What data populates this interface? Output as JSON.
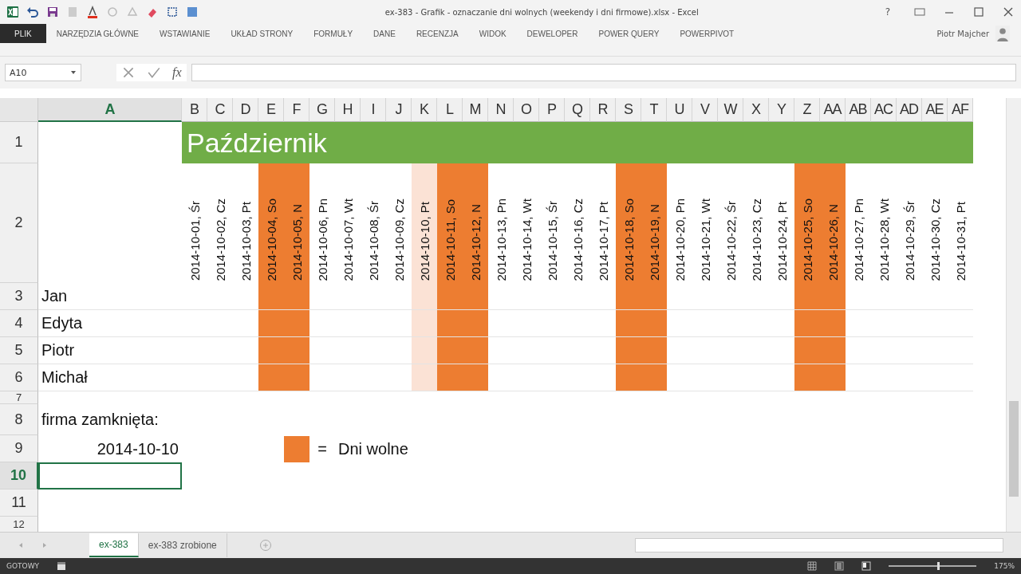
{
  "title_bar": {
    "title": "ex-383 - Grafik - oznaczanie dni wolnych (weekendy i dni firmowe).xlsx - Excel",
    "help": "?"
  },
  "ribbon_tabs": [
    {
      "label": "PLIK",
      "kind": "file",
      "selected": false
    },
    {
      "label": "NARZĘDZIA GŁÓWNE",
      "kind": "tab",
      "selected": false
    },
    {
      "label": "WSTAWIANIE",
      "kind": "tab",
      "selected": false
    },
    {
      "label": "UKŁAD STRONY",
      "kind": "tab",
      "selected": false
    },
    {
      "label": "FORMUŁY",
      "kind": "tab",
      "selected": false
    },
    {
      "label": "DANE",
      "kind": "tab",
      "selected": false
    },
    {
      "label": "RECENZJA",
      "kind": "tab",
      "selected": false
    },
    {
      "label": "WIDOK",
      "kind": "tab",
      "selected": false
    },
    {
      "label": "DEWELOPER",
      "kind": "tab",
      "selected": false
    },
    {
      "label": "POWER QUERY",
      "kind": "tab",
      "selected": false
    },
    {
      "label": "POWERPIVOT",
      "kind": "tab",
      "selected": false
    }
  ],
  "user": "Piotr Majcher",
  "formula_bar": {
    "name_box": "A10",
    "fx": "fx"
  },
  "sheet": {
    "first_column": {
      "letter": "A",
      "selected": true
    },
    "month_title": "Październik",
    "days": [
      {
        "letter": "B",
        "label": "2014-10-01, Śr",
        "kind": "workday"
      },
      {
        "letter": "C",
        "label": "2014-10-02, Cz",
        "kind": "workday"
      },
      {
        "letter": "D",
        "label": "2014-10-03, Pt",
        "kind": "workday"
      },
      {
        "letter": "E",
        "label": "2014-10-04, So",
        "kind": "weekend"
      },
      {
        "letter": "F",
        "label": "2014-10-05, N",
        "kind": "weekend"
      },
      {
        "letter": "G",
        "label": "2014-10-06, Pn",
        "kind": "workday"
      },
      {
        "letter": "H",
        "label": "2014-10-07, Wt",
        "kind": "workday"
      },
      {
        "letter": "I",
        "label": "2014-10-08, Śr",
        "kind": "workday"
      },
      {
        "letter": "J",
        "label": "2014-10-09, Cz",
        "kind": "workday"
      },
      {
        "letter": "K",
        "label": "2014-10-10, Pt",
        "kind": "closed"
      },
      {
        "letter": "L",
        "label": "2014-10-11, So",
        "kind": "weekend"
      },
      {
        "letter": "M",
        "label": "2014-10-12, N",
        "kind": "weekend"
      },
      {
        "letter": "N",
        "label": "2014-10-13, Pn",
        "kind": "workday"
      },
      {
        "letter": "O",
        "label": "2014-10-14, Wt",
        "kind": "workday"
      },
      {
        "letter": "P",
        "label": "2014-10-15, Śr",
        "kind": "workday"
      },
      {
        "letter": "Q",
        "label": "2014-10-16, Cz",
        "kind": "workday"
      },
      {
        "letter": "R",
        "label": "2014-10-17, Pt",
        "kind": "workday"
      },
      {
        "letter": "S",
        "label": "2014-10-18, So",
        "kind": "weekend"
      },
      {
        "letter": "T",
        "label": "2014-10-19, N",
        "kind": "weekend"
      },
      {
        "letter": "U",
        "label": "2014-10-20, Pn",
        "kind": "workday"
      },
      {
        "letter": "V",
        "label": "2014-10-21, Wt",
        "kind": "workday"
      },
      {
        "letter": "W",
        "label": "2014-10-22, Śr",
        "kind": "workday"
      },
      {
        "letter": "X",
        "label": "2014-10-23, Cz",
        "kind": "workday"
      },
      {
        "letter": "Y",
        "label": "2014-10-24, Pt",
        "kind": "workday"
      },
      {
        "letter": "Z",
        "label": "2014-10-25, So",
        "kind": "weekend"
      },
      {
        "letter": "AA",
        "label": "2014-10-26, N",
        "kind": "weekend"
      },
      {
        "letter": "AB",
        "label": "2014-10-27, Pn",
        "kind": "workday"
      },
      {
        "letter": "AC",
        "label": "2014-10-28, Wt",
        "kind": "workday"
      },
      {
        "letter": "AD",
        "label": "2014-10-29, Śr",
        "kind": "workday"
      },
      {
        "letter": "AE",
        "label": "2014-10-30, Cz",
        "kind": "workday"
      },
      {
        "letter": "AF",
        "label": "2014-10-31, Pt",
        "kind": "workday"
      }
    ],
    "people": [
      "Jan",
      "Edyta",
      "Piotr",
      "Michał"
    ],
    "closed_label": "firma zamknięta:",
    "closed_date": "2014-10-10",
    "legend": {
      "color": "#ed7d31",
      "symbol": "=",
      "label": "Dni wolne"
    },
    "row_headers": [
      {
        "label": "1",
        "selected": false
      },
      {
        "label": "2",
        "selected": false
      },
      {
        "label": "3",
        "selected": false
      },
      {
        "label": "4",
        "selected": false
      },
      {
        "label": "5",
        "selected": false
      },
      {
        "label": "6",
        "selected": false
      },
      {
        "label": "7",
        "selected": false
      },
      {
        "label": "8",
        "selected": false
      },
      {
        "label": "9",
        "selected": false
      },
      {
        "label": "10",
        "selected": true
      },
      {
        "label": "11",
        "selected": false
      },
      {
        "label": "12",
        "selected": false
      }
    ]
  },
  "sheet_tabs": [
    {
      "label": "ex-383",
      "selected": true
    },
    {
      "label": "ex-383 zrobione",
      "selected": false
    }
  ],
  "status_bar": {
    "status": "GOTOWY",
    "zoom_slider": {
      "level": 0.55
    },
    "zoom": "175%"
  }
}
